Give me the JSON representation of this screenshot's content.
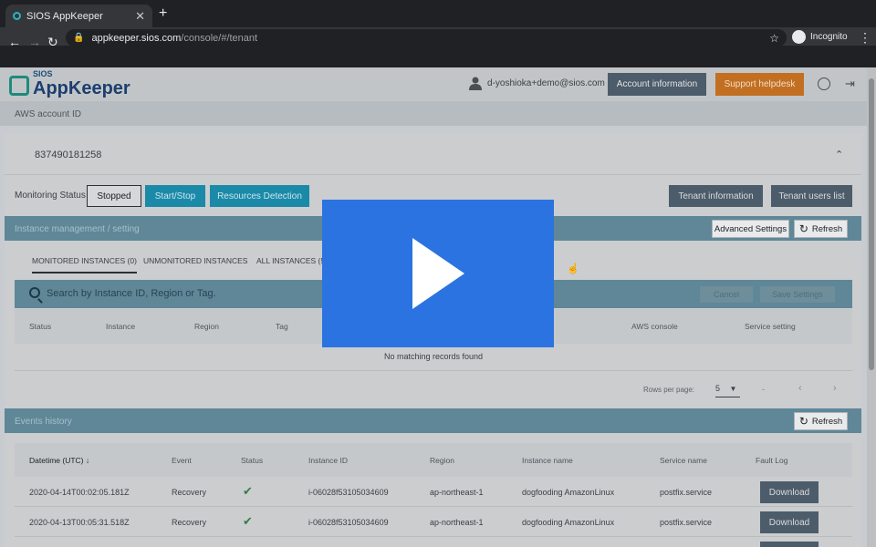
{
  "browser": {
    "tab_title": "SIOS AppKeeper",
    "tab_close": "✕",
    "new_tab": "+",
    "url_domain": "appkeeper.sios.com",
    "url_path": "/console/#/tenant",
    "profile_label": "Incognito"
  },
  "header": {
    "logo_top": "SIOS",
    "logo_text": "AppKeeper",
    "user_email": "d-yoshioka+demo@sios.com",
    "account_button": "Account information",
    "support_button": "Support helpdesk"
  },
  "aws_account": {
    "label": "AWS account ID",
    "id": "837490181258"
  },
  "monitoring": {
    "label": "Monitoring Status",
    "status_button": "Stopped",
    "start_stop_button": "Start/Stop",
    "resources_button": "Resources Detection",
    "tenant_info_button": "Tenant information",
    "tenant_users_button": "Tenant users list"
  },
  "instance_section": {
    "title": "Instance management / setting",
    "advanced_button": "Advanced Settings",
    "refresh_button": "Refresh",
    "tabs": [
      "MONITORED INSTANCES (0)",
      "UNMONITORED INSTANCES",
      "ALL INSTANCES (5)"
    ],
    "search_placeholder": "Search by Instance ID, Region or Tag.",
    "cancel_button": "Cancel",
    "save_button": "Save Settings",
    "columns": [
      "Status",
      "Instance",
      "Region",
      "Tag",
      "AWS console",
      "Service setting"
    ],
    "empty_message": "No matching records found",
    "rows_per_page_label": "Rows per page:",
    "rows_per_page_value": "5",
    "range_text": "-"
  },
  "events_section": {
    "title": "Events history",
    "refresh_button": "Refresh",
    "columns": [
      "Datetime (UTC)",
      "Event",
      "Status",
      "Instance ID",
      "Region",
      "Instance name",
      "Service name",
      "Fault Log"
    ],
    "rows": [
      {
        "datetime": "2020-04-14T00:02:05.181Z",
        "event": "Recovery",
        "instance_id": "i-06028f53105034609",
        "region": "ap-northeast-1",
        "instance_name": "dogfooding AmazonLinux",
        "service": "postfix.service",
        "action": "Download"
      },
      {
        "datetime": "2020-04-13T00:05:31.518Z",
        "event": "Recovery",
        "instance_id": "i-06028f53105034609",
        "region": "ap-northeast-1",
        "instance_name": "dogfooding AmazonLinux",
        "service": "postfix.service",
        "action": "Download"
      }
    ]
  },
  "colors": {
    "accent_teal": "#1b8aa8",
    "support_orange": "#c26f22",
    "section_bar": "#5f8798",
    "play_blue": "#2b73e0"
  }
}
